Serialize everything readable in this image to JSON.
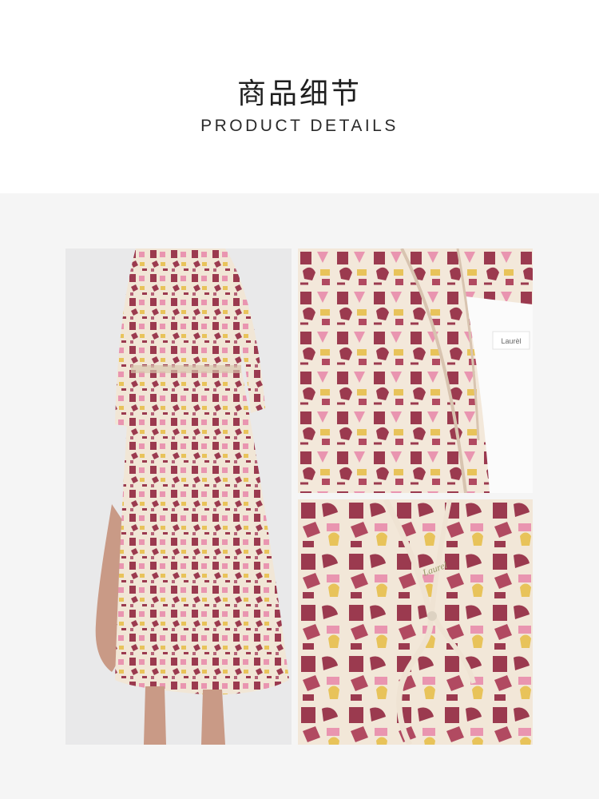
{
  "header": {
    "title_cn": "商品细节",
    "title_en": "PRODUCT DETAILS"
  },
  "photos": {
    "main_alt": "model-wearing-printed-dress",
    "top_detail_alt": "collar-detail",
    "bottom_detail_alt": "tie-neck-detail",
    "label_text": "Laurèl",
    "print_text": "Laurel"
  },
  "colors": {
    "background": "#f5f5f5",
    "fabric_base": "#f1e6d6",
    "print_burgundy": "#9b3a4f",
    "print_pink": "#e995b0",
    "print_yellow": "#e8c35a"
  }
}
